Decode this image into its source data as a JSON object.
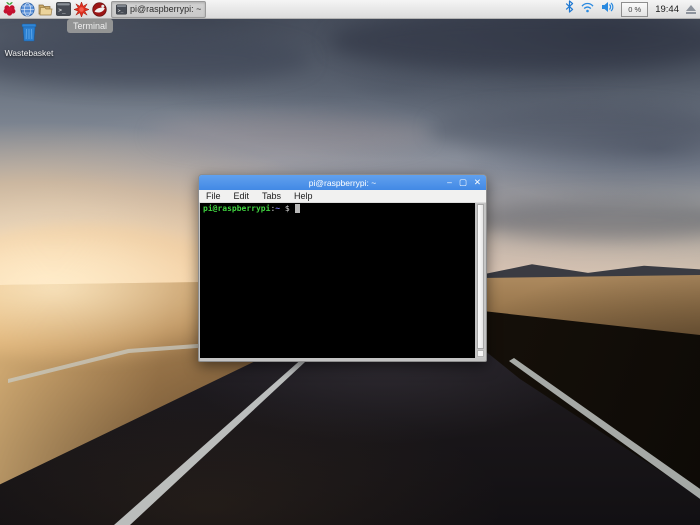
{
  "taskbar": {
    "launcher_icons": [
      "raspberry-menu",
      "web-browser-globe",
      "file-manager-folders",
      "terminal",
      "red-starburst-app",
      "red-circle-app"
    ],
    "window_button_label": "pi@raspberrypi: ~",
    "tooltip": "Terminal",
    "tray_icons": [
      "bluetooth",
      "wifi",
      "volume",
      "cpu-monitor",
      "clock",
      "eject"
    ],
    "cpu_usage": "0 %",
    "clock": "19:44"
  },
  "desktop": {
    "wastebasket_label": "Wastebasket"
  },
  "window": {
    "title": "pi@raspberrypi: ~",
    "menus": [
      "File",
      "Edit",
      "Tabs",
      "Help"
    ],
    "controls": {
      "minimize": "–",
      "maximize": "▢",
      "close": "✕"
    },
    "terminal": {
      "user_host": "pi@raspberrypi",
      "colon": ":",
      "cwd": "~",
      "dollar": " $ "
    }
  },
  "colors": {
    "titlebar_blue": "#4a90e8",
    "prompt_green": "#3fd23f",
    "prompt_blue": "#7c7cf2",
    "taskbar_gray": "#e8e8e8"
  }
}
